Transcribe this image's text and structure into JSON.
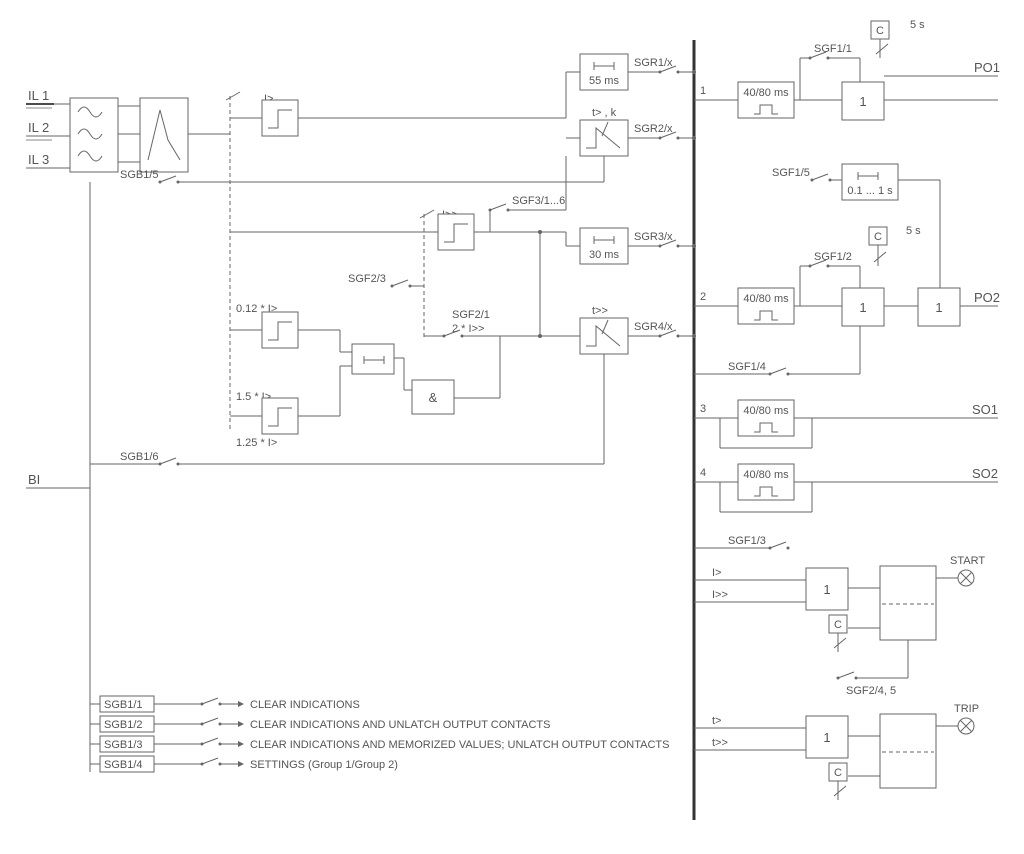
{
  "inputs": {
    "il1": "IL 1",
    "il2": "IL 2",
    "il3": "IL 3",
    "bi": "BI"
  },
  "sgb": {
    "s5": "SGB1/5",
    "s6": "SGB1/6",
    "s1": "SGB1/1",
    "s2": "SGB1/2",
    "s3": "SGB1/3",
    "s4": "SGB1/4"
  },
  "sgf": {
    "f23": "SGF2/3",
    "f21": "SGF2/1",
    "f21b": "2 * I>>",
    "f316": "SGF3/1...6",
    "f11": "SGF1/1",
    "f12": "SGF1/2",
    "f13": "SGF1/3",
    "f14": "SGF1/4",
    "f15": "SGF1/5",
    "f245": "SGF2/4, 5"
  },
  "sgr": {
    "r1": "SGR1/x",
    "r2": "SGR2/x",
    "r3": "SGR3/x",
    "r4": "SGR4/x"
  },
  "timers": {
    "t55": "55 ms",
    "t30": "30 ms",
    "t4080": "40/80 ms",
    "t0101": "0.1 ... 1 s",
    "t5s": "5 s"
  },
  "gates": {
    "and": "&",
    "one": "1"
  },
  "outputs": {
    "po1": "PO1",
    "po2": "PO2",
    "so1": "SO1",
    "so2": "SO2",
    "start": "START",
    "trip": "TRIP"
  },
  "labels": {
    "igt": "I>",
    "igtt": "I>>",
    "tgt": "t>",
    "tgtt": "t>>",
    "tgtk": "t> , k",
    "k012": "0.12 * I>",
    "k15": "1.5 * I>",
    "k125": "1.25 * I>",
    "c": "C"
  },
  "cmds": {
    "c1": "CLEAR INDICATIONS",
    "c2": "CLEAR INDICATIONS AND UNLATCH OUTPUT CONTACTS",
    "c3": "CLEAR INDICATIONS AND MEMORIZED VALUES; UNLATCH OUTPUT CONTACTS",
    "c4": "SETTINGS (Group 1/Group 2)"
  },
  "bus": {
    "n1": "1",
    "n2": "2",
    "n3": "3",
    "n4": "4"
  }
}
